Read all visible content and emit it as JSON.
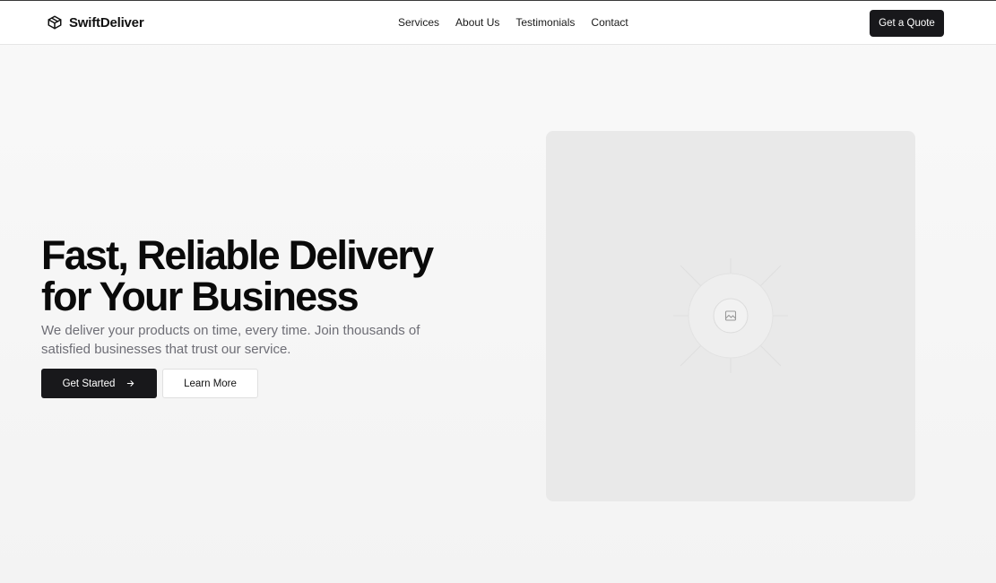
{
  "header": {
    "brand_name": "SwiftDeliver",
    "brand_icon": "package-icon",
    "nav": [
      {
        "label": "Services"
      },
      {
        "label": "About Us"
      },
      {
        "label": "Testimonials"
      },
      {
        "label": "Contact"
      }
    ],
    "cta_label": "Get a Quote"
  },
  "hero": {
    "title_line1": "Fast, Reliable Delivery",
    "title_line2": "for Your Business",
    "subtitle": "We deliver your products on time, every time. Join thousands of satisfied businesses that trust our service.",
    "primary_button": "Get Started",
    "primary_button_icon": "arrow-right-icon",
    "secondary_button": "Learn More",
    "image_icon": "image-placeholder-icon"
  },
  "colors": {
    "primary": "#18181b",
    "muted_text": "#6e6e76",
    "image_bg": "#e9e9e9"
  }
}
